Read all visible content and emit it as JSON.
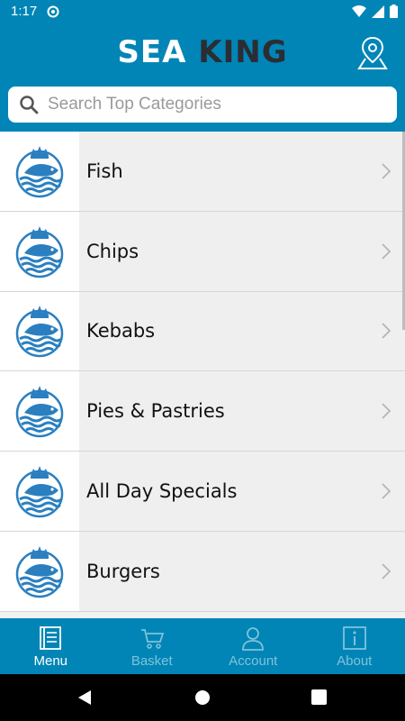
{
  "status_bar": {
    "time": "1:17"
  },
  "header": {
    "logo_part1": "SEA",
    "logo_part2": "KING",
    "location_icon": "map-pin-icon"
  },
  "search": {
    "placeholder": "Search Top Categories",
    "value": ""
  },
  "categories": [
    {
      "label": "Fish"
    },
    {
      "label": "Chips"
    },
    {
      "label": "Kebabs"
    },
    {
      "label": "Pies & Pastries"
    },
    {
      "label": "All Day Specials"
    },
    {
      "label": "Burgers"
    }
  ],
  "bottom_nav": {
    "items": [
      {
        "label": "Menu",
        "icon": "menu-list-icon",
        "active": true
      },
      {
        "label": "Basket",
        "icon": "basket-icon",
        "active": false
      },
      {
        "label": "Account",
        "icon": "account-icon",
        "active": false
      },
      {
        "label": "About",
        "icon": "info-icon",
        "active": false
      }
    ]
  },
  "colors": {
    "brand_blue": "#0085b6",
    "logo_dark": "#2b2d33",
    "inactive_nav": "#7fc2da"
  }
}
